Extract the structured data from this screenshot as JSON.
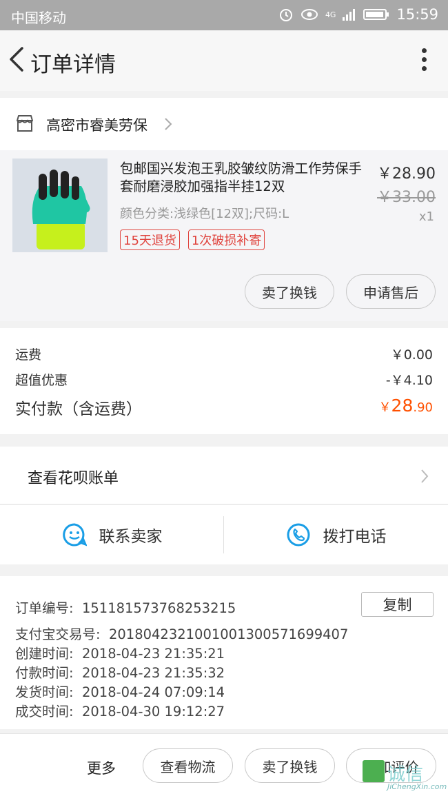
{
  "status_bar": {
    "carrier": "中国移动",
    "network": "4G",
    "time": "15:59"
  },
  "header": {
    "title": "订单详情"
  },
  "shop": {
    "name": "高密市睿美劳保"
  },
  "product": {
    "name": "包邮国兴发泡王乳胶皱纹防滑工作劳保手套耐磨浸胶加强指半挂12双",
    "sku": "颜色分类:浅绿色[12双];尺码:L",
    "tags": [
      "15天退货",
      "1次破损补寄"
    ],
    "price": "￥28.90",
    "original_price": "￥33.00",
    "quantity": "x1",
    "buttons": [
      "卖了换钱",
      "申请售后"
    ]
  },
  "fees": {
    "shipping_label": "运费",
    "shipping_value": "￥0.00",
    "discount_label": "超值优惠",
    "discount_value": "-￥4.10",
    "paid_label": "实付款（含运费）",
    "paid_currency": "￥",
    "paid_int": "28",
    "paid_dec": ".90"
  },
  "huabei": {
    "label": "查看花呗账单"
  },
  "contact": {
    "seller_label": "联系卖家",
    "phone_label": "拨打电话"
  },
  "order_info": {
    "order_no_label": "订单编号:",
    "order_no": "151181573768253215",
    "copy_label": "复制",
    "alipay_label": "支付宝交易号:",
    "alipay_no": "2018042321001001300571699407",
    "created_label": "创建时间:",
    "created": "2018-04-23 21:35:21",
    "paid_label": "付款时间:",
    "paid": "2018-04-23 21:35:32",
    "shipped_label": "发货时间:",
    "shipped": "2018-04-24 07:09:14",
    "done_label": "成交时间:",
    "done": "2018-04-30 19:12:27"
  },
  "bottom_bar": {
    "more_label": "更多",
    "buttons": [
      "查看物流",
      "卖了换钱",
      "追加评价"
    ]
  },
  "watermark": {
    "text": "诚信",
    "sub": "JiChengXin.com"
  },
  "colors": {
    "accent_orange": "#ff5000",
    "tag_red": "#e0443e",
    "icon_blue": "#1a9ee6"
  },
  "icons": {
    "back": "chevron-left-icon",
    "more": "more-vertical-icon",
    "shop": "shop-icon",
    "chat": "chat-bubble-icon",
    "phone": "phone-icon"
  }
}
